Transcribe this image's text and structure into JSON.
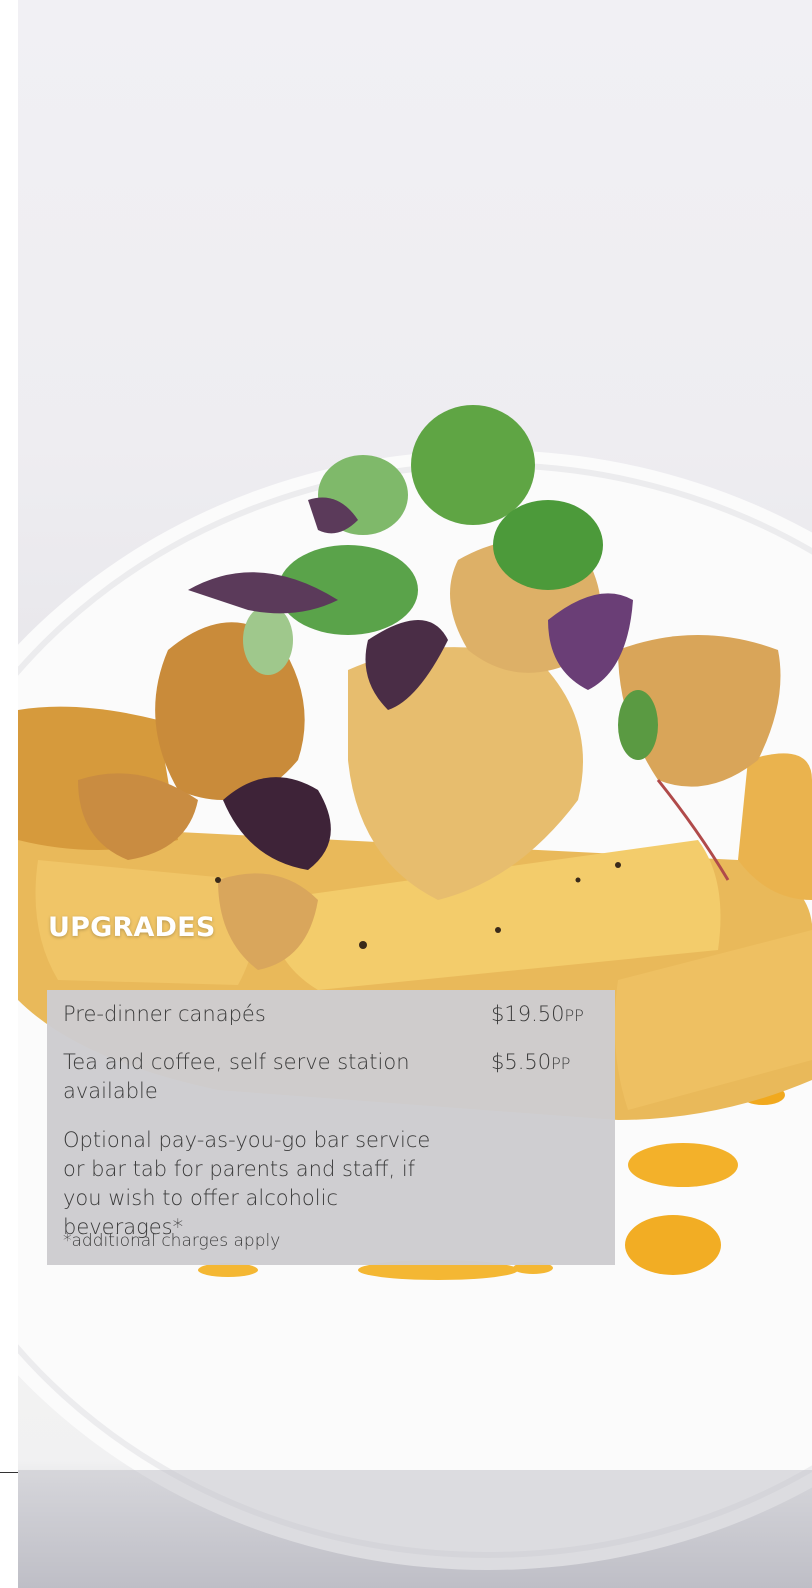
{
  "section": {
    "title": "UPGRADES"
  },
  "items": [
    {
      "name": "Pre-dinner canapés",
      "price": "$19.50",
      "unit": "PP"
    },
    {
      "name": "Tea and coffee, self serve station available",
      "price": "$5.50",
      "unit": "PP"
    },
    {
      "name": "Optional pay-as-you-go bar service or bar tab for parents and staff, if you wish to offer alcoholic beverages*",
      "price": "",
      "unit": ""
    }
  ],
  "footnote": "*additional charges apply"
}
